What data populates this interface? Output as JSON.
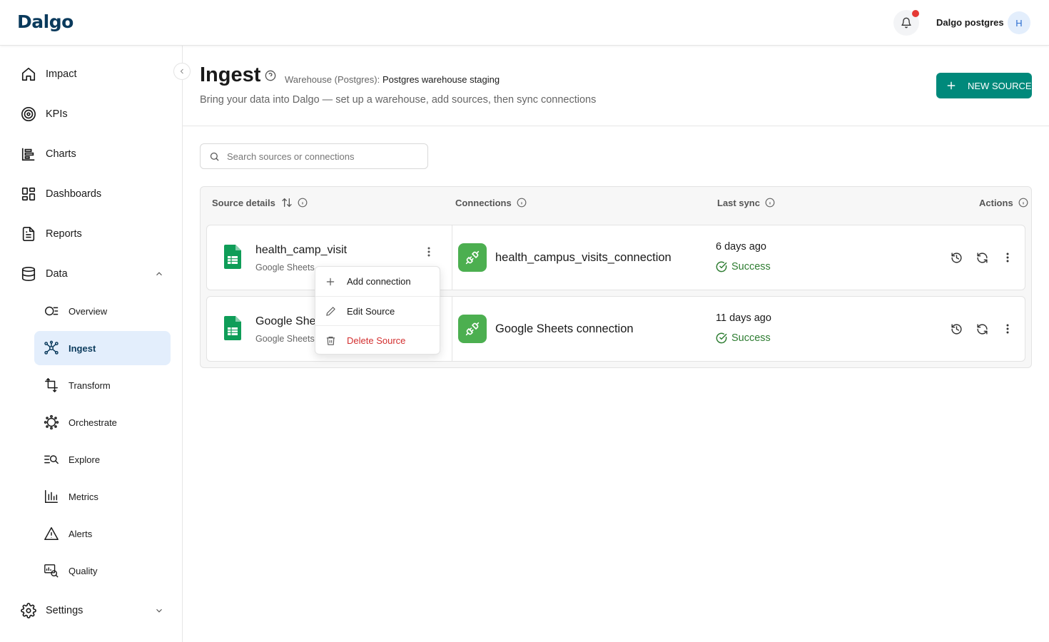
{
  "app": {
    "logo": "Dalgo",
    "username": "Dalgo postgres",
    "avatar_initial": "H"
  },
  "sidebar": {
    "items": [
      {
        "label": "Impact",
        "icon": "home-icon"
      },
      {
        "label": "KPIs",
        "icon": "target-icon"
      },
      {
        "label": "Charts",
        "icon": "chart-icon"
      },
      {
        "label": "Dashboards",
        "icon": "dashboard-icon"
      },
      {
        "label": "Reports",
        "icon": "report-icon"
      },
      {
        "label": "Data",
        "icon": "database-icon",
        "expanded": true
      }
    ],
    "sub_items": [
      {
        "label": "Overview",
        "icon": "overview-icon"
      },
      {
        "label": "Ingest",
        "icon": "ingest-icon",
        "active": true
      },
      {
        "label": "Transform",
        "icon": "transform-icon"
      },
      {
        "label": "Orchestrate",
        "icon": "orchestrate-icon"
      },
      {
        "label": "Explore",
        "icon": "explore-icon"
      },
      {
        "label": "Metrics",
        "icon": "metrics-icon"
      },
      {
        "label": "Alerts",
        "icon": "alert-icon"
      },
      {
        "label": "Quality",
        "icon": "quality-icon"
      }
    ],
    "settings": {
      "label": "Settings",
      "icon": "settings-icon"
    }
  },
  "header": {
    "title": "Ingest",
    "warehouse_label": "Warehouse (Postgres):",
    "warehouse_value": "Postgres warehouse staging",
    "subtitle": "Bring your data into Dalgo — set up a warehouse, add sources, then sync connections",
    "new_source_label": "NEW SOURCE"
  },
  "search": {
    "placeholder": "Search sources or connections",
    "value": ""
  },
  "table": {
    "columns": [
      "Source details",
      "Connections",
      "Last sync",
      "Actions"
    ],
    "rows": [
      {
        "source_name": "health_camp_visit",
        "source_type": "Google Sheets",
        "connection": "health_campus_visits_connection",
        "last_sync": "6 days ago",
        "status": "Success"
      },
      {
        "source_name": "Google She",
        "source_type": "Google Sheets",
        "connection": "Google Sheets connection",
        "last_sync": "11 days ago",
        "status": "Success"
      }
    ]
  },
  "menu": {
    "items": [
      {
        "label": "Add connection",
        "icon": "plus-icon"
      },
      {
        "label": "Edit Source",
        "icon": "pencil-icon"
      },
      {
        "label": "Delete Source",
        "icon": "trash-icon"
      }
    ]
  },
  "colors": {
    "accent": "#00897b",
    "success": "#2e7d32",
    "danger": "#d32f2f",
    "active_bg": "#e3eefc",
    "connector_green": "#4caf50"
  }
}
